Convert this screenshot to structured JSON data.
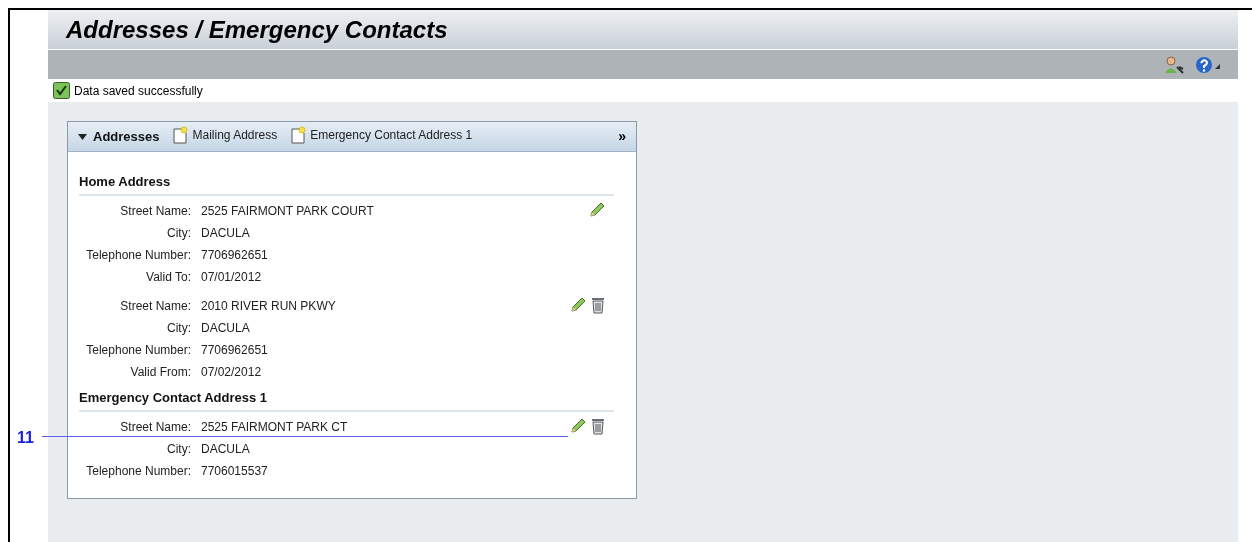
{
  "page_title": "Addresses / Emergency Contacts",
  "message": {
    "text": "Data saved successfully",
    "kind": "success"
  },
  "panel": {
    "title": "Addresses",
    "expanded": true,
    "create_links": [
      {
        "label": "Mailing Address"
      },
      {
        "label": "Emergency Contact Address 1"
      }
    ],
    "more": "»",
    "sections": [
      {
        "title": "Home Address",
        "records": [
          {
            "fields": [
              {
                "label": "Street Name:",
                "value": "2525 FAIRMONT PARK COURT"
              },
              {
                "label": "City:",
                "value": "DACULA"
              },
              {
                "label": "Telephone Number:",
                "value": "7706962651"
              },
              {
                "label": "Valid To:",
                "value": "07/01/2012"
              }
            ],
            "editable": true,
            "deletable": false
          },
          {
            "fields": [
              {
                "label": "Street Name:",
                "value": "2010 RIVER RUN PKWY"
              },
              {
                "label": "City:",
                "value": "DACULA"
              },
              {
                "label": "Telephone Number:",
                "value": "7706962651"
              },
              {
                "label": "Valid From:",
                "value": "07/02/2012"
              }
            ],
            "editable": true,
            "deletable": true
          }
        ]
      },
      {
        "title": "Emergency Contact Address 1",
        "records": [
          {
            "fields": [
              {
                "label": "Street Name:",
                "value": "2525 FAIRMONT PARK CT"
              },
              {
                "label": "City:",
                "value": "DACULA"
              },
              {
                "label": "Telephone Number:",
                "value": "7706015537"
              }
            ],
            "editable": true,
            "deletable": true
          }
        ]
      }
    ]
  },
  "callout": {
    "label": "11"
  }
}
